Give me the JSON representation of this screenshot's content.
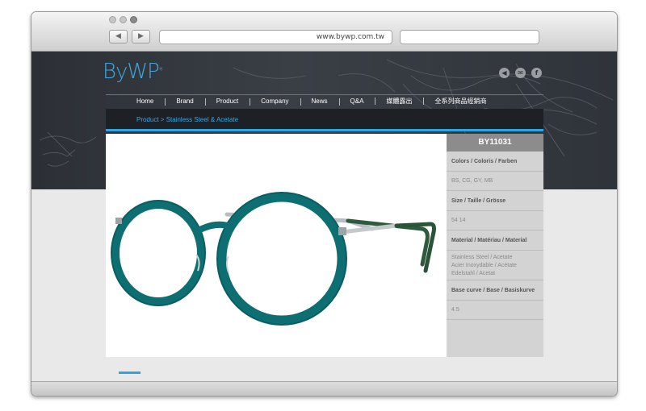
{
  "browser": {
    "back_glyph": "◀",
    "forward_glyph": "▶",
    "url": "www.bywp.com.tw",
    "search_value": ""
  },
  "site": {
    "logo": "ByWP",
    "logo_mark": "®",
    "social": [
      {
        "name": "sound-icon",
        "glyph": "◀"
      },
      {
        "name": "mail-icon",
        "glyph": "✉"
      },
      {
        "name": "facebook-icon",
        "glyph": "f"
      }
    ],
    "menu": [
      "Home",
      "Brand",
      "Product",
      "Company",
      "News",
      "Q&A",
      "媒體露出",
      "全系列商品經銷商"
    ],
    "breadcrumb": "Product  >  Stainless Steel & Acetate",
    "accent_color": "#2da4e6"
  },
  "product": {
    "model": "BY11031",
    "specs": [
      {
        "label": "Colors / Coloris / Farben",
        "value": "BS, CG, GY, MB"
      },
      {
        "label": "Size / Taille / Grösse",
        "value": "54 14"
      },
      {
        "label": "Material / Matériau / Material",
        "value": "Stainless Steel / Acetate\nAcier Inoxydable / Acétate\nEdelstahl / Acetat"
      },
      {
        "label": "Base curve / Base / Basiskurve",
        "value": "4.5"
      }
    ],
    "frame_color": "#0e6f73"
  }
}
